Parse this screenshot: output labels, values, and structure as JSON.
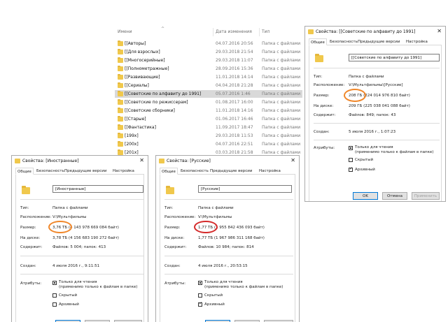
{
  "explorer": {
    "columns": {
      "name": "Имени",
      "date": "Дата изменения",
      "type": "Тип"
    },
    "rows": [
      {
        "name": "[[Авторы]",
        "date": "04.07.2016 20:56",
        "type": "Папка с файлами",
        "selected": false
      },
      {
        "name": "[[Для взрослых]",
        "date": "29.03.2018 21:54",
        "type": "Папка с файлами",
        "selected": false
      },
      {
        "name": "[[Многосерийные]",
        "date": "29.03.2018 11:07",
        "type": "Папка с файлами",
        "selected": false
      },
      {
        "name": "[[Полнометражные]",
        "date": "28.09.2016 15:36",
        "type": "Папка с файлами",
        "selected": false
      },
      {
        "name": "[[Развивающие]",
        "date": "11.01.2018 14:14",
        "type": "Папка с файлами",
        "selected": false
      },
      {
        "name": "[[Сериалы]",
        "date": "04.04.2018 21:28",
        "type": "Папка с файлами",
        "selected": false
      },
      {
        "name": "[[Советские по алфавиту до 1991]",
        "date": "05.07.2016 1:46",
        "type": "Папка с файлами",
        "selected": true
      },
      {
        "name": "[[Советские по режиссерам]",
        "date": "01.08.2017 16:00",
        "type": "Папка с файлами",
        "selected": false
      },
      {
        "name": "[[Советские сборники]",
        "date": "11.01.2018 14:16",
        "type": "Папка с файлами",
        "selected": false
      },
      {
        "name": "[[Старые]",
        "date": "01.06.2017 16:46",
        "type": "Папка с файлами",
        "selected": false
      },
      {
        "name": "[[Фантастика]",
        "date": "11.09.2017 18:47",
        "type": "Папка с файлами",
        "selected": false
      },
      {
        "name": "[199x]",
        "date": "29.03.2018 11:53",
        "type": "Папка с файлами",
        "selected": false
      },
      {
        "name": "[200x]",
        "date": "04.07.2016 22:51",
        "type": "Папка с файлами",
        "selected": false
      },
      {
        "name": "[201x]",
        "date": "03.03.2018 21:58",
        "type": "Папка с файлами",
        "selected": false
      }
    ]
  },
  "dialog_common": {
    "tabs": [
      "Общие",
      "Безопасность",
      "Предыдущие версии",
      "Настройка"
    ],
    "labels": {
      "type": "Тип:",
      "location": "Расположение:",
      "size": "Размер:",
      "on_disk": "На диске:",
      "contains": "Содержит:",
      "created": "Создан:",
      "attributes": "Атрибуты:"
    },
    "attributes": {
      "readonly": "Только для чтения",
      "readonly_note": "(применимо только к файлам в папке)",
      "hidden": "Скрытый",
      "archive": "Архивный"
    },
    "buttons": {
      "ok": "OK",
      "cancel": "Отмена",
      "apply": "Применить"
    },
    "type_value": "Папка с файлами"
  },
  "dialog_soviet": {
    "title": "Свойства: [[Советские по алфавиту до 1991]",
    "name": "[[Советские по алфавиту до 1991]",
    "location": "V:\\Мультфильмы\\[Русские]",
    "size_highlight": "208 ГБ",
    "size_rest": "(224 014 976 810 байт)",
    "on_disk": "209 ГБ (225 038 041 088 байт)",
    "contains": "Файлов: 849; папок: 43",
    "created": "5 июля 2016 г., 1:07:23",
    "archive_checked": true,
    "highlight_color": "#f0872a"
  },
  "dialog_foreign": {
    "title": "Свойства: [Иностранные]",
    "name": "[Иностранные]",
    "location": "V:\\Мультфильмы",
    "size_highlight": "3,76 ТБ",
    "size_rest": "(4 143 978 669 084 байт)",
    "on_disk": "3,78 ТБ (4 156 683 190 272 байт)",
    "contains": "Файлов: 5 004; папок: 413",
    "created": "4 июля 2016 г., 9:11:51",
    "archive_checked": false,
    "highlight_color": "#f0872a"
  },
  "dialog_russian": {
    "title": "Свойства: [Русские]",
    "name": "[Русские]",
    "location": "V:\\Мультфильмы",
    "size_highlight": "1,77 ТБ",
    "size_rest": "(1 955 842 436 093 байт)",
    "on_disk": "1,77 ТБ (1 967 986 311 168 байт)",
    "contains": "Файлов: 10 984; папок: 814",
    "created": "4 июля 2016 г., 20:53:15",
    "archive_checked": true,
    "highlight_color": "#d42a2a"
  }
}
